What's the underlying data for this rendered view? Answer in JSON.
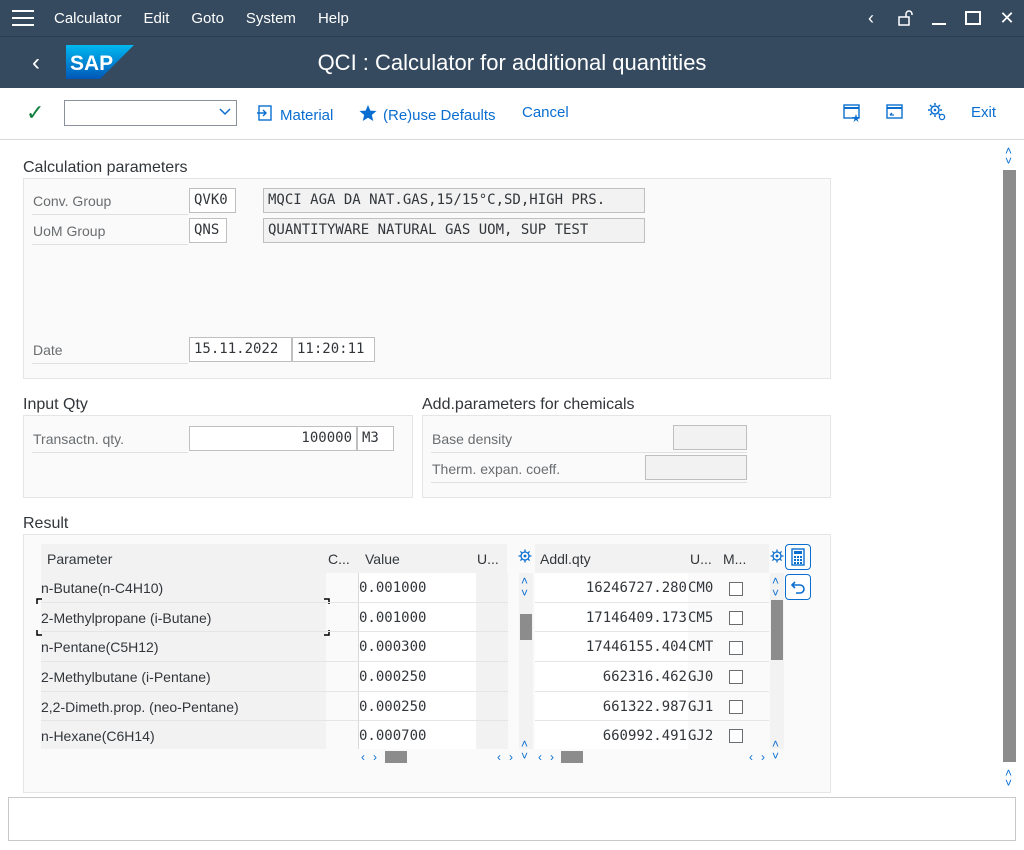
{
  "menu": {
    "items": [
      "Calculator",
      "Edit",
      "Goto",
      "System",
      "Help"
    ]
  },
  "title": "QCI : Calculator for additional quantities",
  "logo_text": "SAP",
  "toolbar": {
    "command_value": "",
    "material_label": "Material",
    "reuse_label": "(Re)use Defaults",
    "cancel_label": "Cancel",
    "exit_label": "Exit"
  },
  "calc": {
    "title": "Calculation parameters",
    "conv_group_label": "Conv. Group",
    "conv_group_value": "QVK0",
    "conv_group_desc": "MQCI AGA DA NAT.GAS,15/15°C,SD,HIGH PRS.",
    "uom_group_label": "UoM Group",
    "uom_group_value": "QNS",
    "uom_group_desc": "QUANTITYWARE NATURAL GAS UOM, SUP TEST",
    "date_label": "Date",
    "date_value": "15.11.2022",
    "time_value": "11:20:11"
  },
  "input": {
    "title": "Input Qty",
    "qty_label": "Transactn. qty.",
    "qty_value": "100000",
    "qty_unit": "M3"
  },
  "chem": {
    "title": "Add.parameters for chemicals",
    "base_density_label": "Base density",
    "base_density_value": "",
    "therm_label": "Therm. expan. coeff.",
    "therm_value": ""
  },
  "result": {
    "title": "Result",
    "left_headers": [
      "Parameter",
      "C...",
      "Value",
      "U..."
    ],
    "right_headers": [
      "Addl.qty",
      "U...",
      "M..."
    ],
    "rows": [
      {
        "param": "n-Butane(n-C4H10)",
        "value": "0.001000",
        "qty": "16246727.280",
        "unit": "CM0"
      },
      {
        "param": "2-Methylpropane (i-Butane)",
        "value": "0.001000",
        "qty": "17146409.173",
        "unit": "CM5"
      },
      {
        "param": "n-Pentane(C5H12)",
        "value": "0.000300",
        "qty": "17446155.404",
        "unit": "CMT"
      },
      {
        "param": "2-Methylbutane (i-Pentane)",
        "value": "0.000250",
        "qty": "662316.462",
        "unit": "GJ0"
      },
      {
        "param": "2,2-Dimeth.prop. (neo-Pentane)",
        "value": "0.000250",
        "qty": "661322.987",
        "unit": "GJ1"
      },
      {
        "param": "n-Hexane(C6H14)",
        "value": "0.000700",
        "qty": "660992.491",
        "unit": "GJ2"
      }
    ]
  },
  "status": {
    "message": ""
  }
}
